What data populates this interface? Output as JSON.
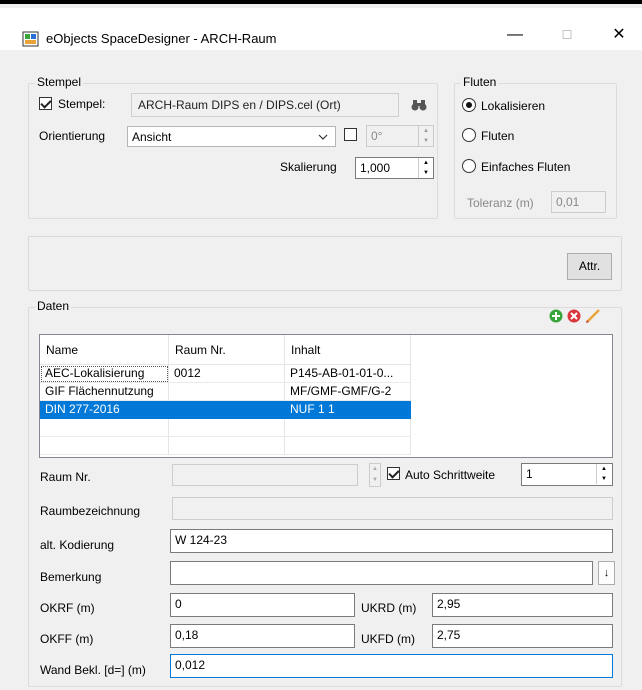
{
  "window": {
    "title": "eObjects SpaceDesigner - ARCH-Raum",
    "minimize": "—",
    "maximize": "☐",
    "close": "✕"
  },
  "stempel": {
    "group_title": "Stempel",
    "checkbox_label": "Stempel:",
    "checked": true,
    "value": "ARCH-Raum DIPS en / DIPS.cel (Ort)",
    "orient_label": "Orientierung",
    "orient_value": "Ansicht",
    "angle_value": "0°",
    "scale_label": "Skalierung",
    "scale_value": "1,000"
  },
  "fluten": {
    "group_title": "Fluten",
    "options": [
      "Lokalisieren",
      "Fluten",
      "Einfaches Fluten"
    ],
    "selected_index": 0,
    "tolerance_label": "Toleranz (m)",
    "tolerance_value": "0,01"
  },
  "attr_button": "Attr.",
  "daten": {
    "group_title": "Daten",
    "columns": [
      "Name",
      "Raum Nr.",
      "Inhalt"
    ],
    "rows": [
      [
        "AEC-Lokalisierung",
        "0012",
        "P145-AB-01-01-0..."
      ],
      [
        "GIF Flächennutzung",
        "",
        "MF/GMF-GMF/G-2"
      ],
      [
        "DIN 277-2016",
        "",
        "NUF 1  1"
      ]
    ],
    "selected_row": 2
  },
  "form": {
    "raum_nr_label": "Raum Nr.",
    "raum_nr_value": "",
    "auto_label": "Auto Schrittweite",
    "auto_checked": true,
    "auto_value": "1",
    "raumbez_label": "Raumbezeichnung",
    "raumbez_value": "",
    "alt_label": "alt. Kodierung",
    "alt_value": "W 124-23",
    "bemerkung_label": "Bemerkung",
    "bemerkung_value": "",
    "bemerkung_button": "↓",
    "okrf_label": "OKRF (m)",
    "okrf_value": "0",
    "ukrd_label": "UKRD (m)",
    "ukrd_value": "2,95",
    "okff_label": "OKFF (m)",
    "okff_value": "0,18",
    "ukfd_label": "UKFD (m)",
    "ukfd_value": "2,75",
    "wand_label": "Wand Bekl. [d=] (m)",
    "wand_value": "0,012"
  },
  "colors": {
    "accent": "#0078d7",
    "add_icon": "#3aa53a",
    "delete_icon": "#d9363e",
    "edit_icon": "#e8a33b"
  }
}
